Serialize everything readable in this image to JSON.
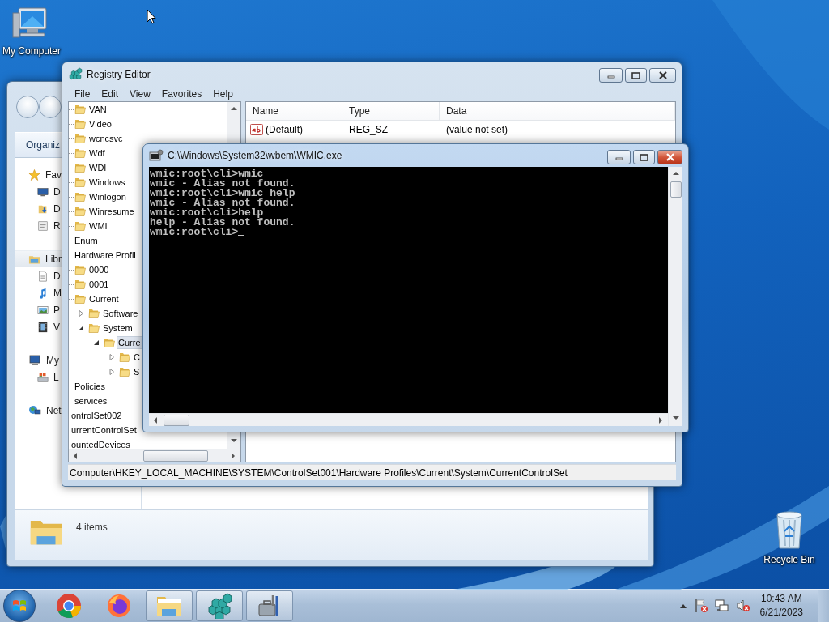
{
  "desktop": {
    "icons": [
      {
        "label": "My Computer",
        "kind": "computer"
      },
      {
        "label": "Recycle Bin",
        "kind": "bin"
      }
    ]
  },
  "explorer": {
    "toolbar": {
      "organize": "Organiz"
    },
    "sidebar": [
      {
        "label": "Fav",
        "kind": "star",
        "selected": false,
        "children": [
          {
            "label": "D",
            "kind": "desktop"
          },
          {
            "label": "D",
            "kind": "download"
          },
          {
            "label": "R",
            "kind": "recent"
          }
        ]
      },
      {
        "label": "Libr",
        "kind": "library",
        "selected": true,
        "children": [
          {
            "label": "D",
            "kind": "document"
          },
          {
            "label": "M",
            "kind": "music"
          },
          {
            "label": "P",
            "kind": "pictures"
          },
          {
            "label": "V",
            "kind": "video"
          }
        ]
      },
      {
        "label": "My",
        "kind": "computer",
        "selected": false,
        "children": [
          {
            "label": "L",
            "kind": "disk"
          }
        ]
      },
      {
        "label": "Net",
        "kind": "network",
        "selected": false
      }
    ],
    "status": "4 items"
  },
  "regedit": {
    "title": "Registry Editor",
    "menu": [
      "File",
      "Edit",
      "View",
      "Favorites",
      "Help"
    ],
    "tree": [
      {
        "children": [
          {
            "children": [
              {
                "label": "VAN",
                "selected": false
              },
              {
                "label": "Video",
                "selected": false
              },
              {
                "label": "wcncsvc",
                "selected": false
              },
              {
                "label": "Wdf",
                "selected": false
              },
              {
                "label": "WDI",
                "selected": false
              },
              {
                "label": "Windows",
                "selected": false
              },
              {
                "label": "Winlogon",
                "selected": false
              },
              {
                "label": "Winresume",
                "selected": false
              },
              {
                "label": "WMI",
                "selected": false
              }
            ]
          },
          {
            "label": "Enum",
            "selected": false
          },
          {
            "label": "Hardware Profil",
            "selected": false,
            "children": [
              {
                "label": "0000",
                "selected": false
              },
              {
                "label": "0001",
                "selected": false
              },
              {
                "label": "Current",
                "selected": false,
                "children": [
                  {
                    "label": "Software",
                    "selected": false,
                    "expanded": false
                  },
                  {
                    "label": "System",
                    "selected": false,
                    "expanded": true,
                    "children": [
                      {
                        "label": "Curre",
                        "selected": true,
                        "expanded": true,
                        "children": [
                          {
                            "label": "C",
                            "selected": false,
                            "expanded": false
                          },
                          {
                            "label": "S",
                            "selected": false,
                            "expanded": false
                          }
                        ]
                      }
                    ]
                  }
                ]
              }
            ]
          },
          {
            "label": "Policies",
            "selected": false
          },
          {
            "label": "services",
            "selected": false
          }
        ]
      },
      {
        "label": "ontrolSet002",
        "selected": false
      },
      {
        "label": "urrentControlSet",
        "selected": false
      },
      {
        "label": "ountedDevices",
        "selected": false
      }
    ],
    "columns": [
      "Name",
      "Type",
      "Data"
    ],
    "rows": [
      {
        "name": "(Default)",
        "type": "REG_SZ",
        "data": "(value not set)"
      }
    ],
    "status_bar": "Computer\\HKEY_LOCAL_MACHINE\\SYSTEM\\ControlSet001\\Hardware Profiles\\Current\\System\\CurrentControlSet"
  },
  "console": {
    "title": "C:\\Windows\\System32\\wbem\\WMIC.exe",
    "lines": [
      "wmic:root\\cli>wmic",
      "wmic - Alias not found.",
      "wmic:root\\cli>wmic help",
      "wmic - Alias not found.",
      "wmic:root\\cli>help",
      "help - Alias not found.",
      "wmic:root\\cli>"
    ]
  },
  "taskbar": {
    "apps": [
      {
        "kind": "chrome",
        "open": false
      },
      {
        "kind": "firefox",
        "open": false
      },
      {
        "kind": "explorer",
        "open": true
      },
      {
        "kind": "regedit",
        "open": true
      },
      {
        "kind": "tools",
        "open": true
      }
    ],
    "clock": {
      "time": "10:43 AM",
      "date": "6/21/2023"
    }
  }
}
